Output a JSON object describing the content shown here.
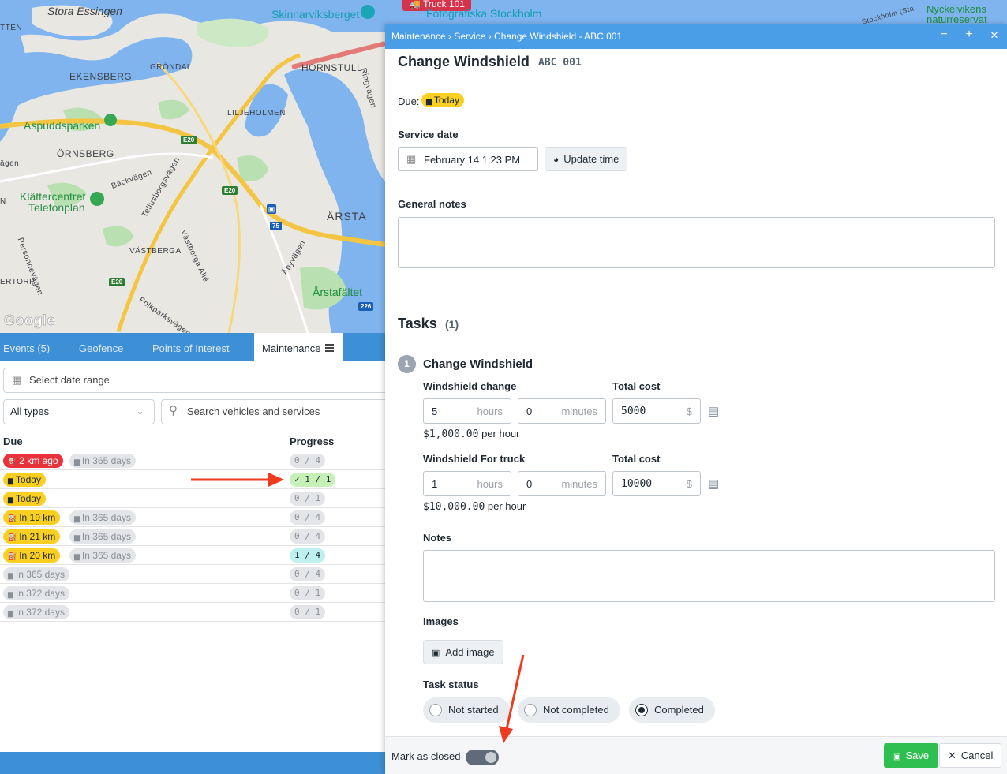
{
  "map": {
    "labels": {
      "stora_essingen": "Stora Essingen",
      "skinnarviksberget": "Skinnarviksberget",
      "fotografiska": "Fotografiska Stockholm",
      "nyckelvikens": "Nyckelvikens",
      "naturreservat": "naturreservat",
      "tten": "TTEN",
      "grondal": "GRÖNDAL",
      "ekensberg": "EKENSBERG",
      "hornstull": "HORNSTULL",
      "ringvagen": "Ringvägen",
      "liljeholmen": "LILJEHOLMEN",
      "aspuddsparken": "Aspuddsparken",
      "ornsberg": "ÖRNSBERG",
      "agen": "ägen",
      "backvagen": "Bäckvägen",
      "klattercentret": "Klättercentret",
      "telefonplan": "Telefonplan",
      "tellusborgsvagen": "Tellusborgsvägen",
      "arsta": "ÅRSTA",
      "vastberga": "VÄSTBERGA",
      "vastberga_alle": "Västberga Allé",
      "abyvagen": "Åbyvägen",
      "personnevagen": "Personnevägen",
      "ertorp": "ERTORP",
      "arstafaltet": "Årstafältet",
      "folkparksvagen": "Folkparksvägen",
      "n": "N",
      "google": "Google",
      "stockholm": "Stockholm (Sta"
    },
    "shields": {
      "e20_a": "E20",
      "e20_b": "E20",
      "e20_c": "E20",
      "r75": "75",
      "r226": "226"
    },
    "vehicle_label": "Truck 101"
  },
  "tabs": {
    "events": "Events (5)",
    "geofence": "Geofence",
    "poi": "Points of Interest",
    "maintenance": "Maintenance"
  },
  "filters": {
    "date_range_placeholder": "Select date range",
    "type_select": "All types",
    "search_placeholder": "Search vehicles and services"
  },
  "table": {
    "headers": {
      "due": "Due",
      "progress": "Progress"
    },
    "rows": [
      {
        "due1": "2 km ago",
        "due1_style": "red",
        "due1_icon": "⛽",
        "due2": "In 365 days",
        "progress": "0 / 4",
        "progress_style": "gry"
      },
      {
        "due1": "Today",
        "due1_style": "yel",
        "due1_icon": "▆",
        "due2": "",
        "progress": "✓ 1 / 1",
        "progress_style": "grn"
      },
      {
        "due1": "Today",
        "due1_style": "yel",
        "due1_icon": "▆",
        "due2": "",
        "progress": "0 / 1",
        "progress_style": "gry"
      },
      {
        "due1": "In 19 km",
        "due1_style": "yel",
        "due1_icon": "⛽",
        "due2": "In 365 days",
        "progress": "0 / 4",
        "progress_style": "gry"
      },
      {
        "due1": "In 21 km",
        "due1_style": "yel",
        "due1_icon": "⛽",
        "due2": "In 365 days",
        "progress": "0 / 4",
        "progress_style": "gry"
      },
      {
        "due1": "In 20 km",
        "due1_style": "yel",
        "due1_icon": "⛽",
        "due2": "In 365 days",
        "progress": "1 / 4",
        "progress_style": "tea"
      },
      {
        "due1": "In 365 days",
        "due1_style": "gry",
        "due1_icon": "▆",
        "due2": "",
        "progress": "0 / 4",
        "progress_style": "gry"
      },
      {
        "due1": "In 372 days",
        "due1_style": "gry",
        "due1_icon": "▆",
        "due2": "",
        "progress": "0 / 1",
        "progress_style": "gry"
      },
      {
        "due1": "In 372 days",
        "due1_style": "gry",
        "due1_icon": "▆",
        "due2": "",
        "progress": "0 / 1",
        "progress_style": "gry"
      }
    ]
  },
  "modal": {
    "breadcrumb": "Maintenance › Service › Change Windshield - ABC 001",
    "title": "Change Windshield",
    "plate": "ABC 001",
    "due_label": "Due:",
    "due_value": "Today",
    "service_date_label": "Service date",
    "service_date_value": "February 14 1:23 PM",
    "update_time_button": "Update time",
    "general_notes_label": "General notes",
    "tasks_heading": "Tasks",
    "tasks_count": "(1)",
    "task_number": "1",
    "task_name": "Change Windshield",
    "line_items": [
      {
        "label": "Windshield change",
        "hours": "5",
        "hours_unit": "hours",
        "minutes": "0",
        "minutes_unit": "minutes",
        "cost_label": "Total cost",
        "cost": "5000",
        "currency": "$",
        "rate": "$1,000.00",
        "rate_suffix": " per hour"
      },
      {
        "label": "Windshield For truck",
        "hours": "1",
        "hours_unit": "hours",
        "minutes": "0",
        "minutes_unit": "minutes",
        "cost_label": "Total cost",
        "cost": "10000",
        "currency": "$",
        "rate": "$10,000.00",
        "rate_suffix": " per hour"
      }
    ],
    "notes_label": "Notes",
    "images_label": "Images",
    "add_image_button": "Add image",
    "task_status_label": "Task status",
    "status_options": [
      "Not started",
      "Not completed",
      "Completed"
    ],
    "status_selected": "Completed",
    "mark_closed_label": "Mark as closed",
    "mark_closed_on": true,
    "save_button": "Save",
    "cancel_button": "Cancel"
  },
  "colors": {
    "accent": "#4a9ee8",
    "save": "#2fbf50",
    "annotation_arrow": "#ee3b1f"
  }
}
